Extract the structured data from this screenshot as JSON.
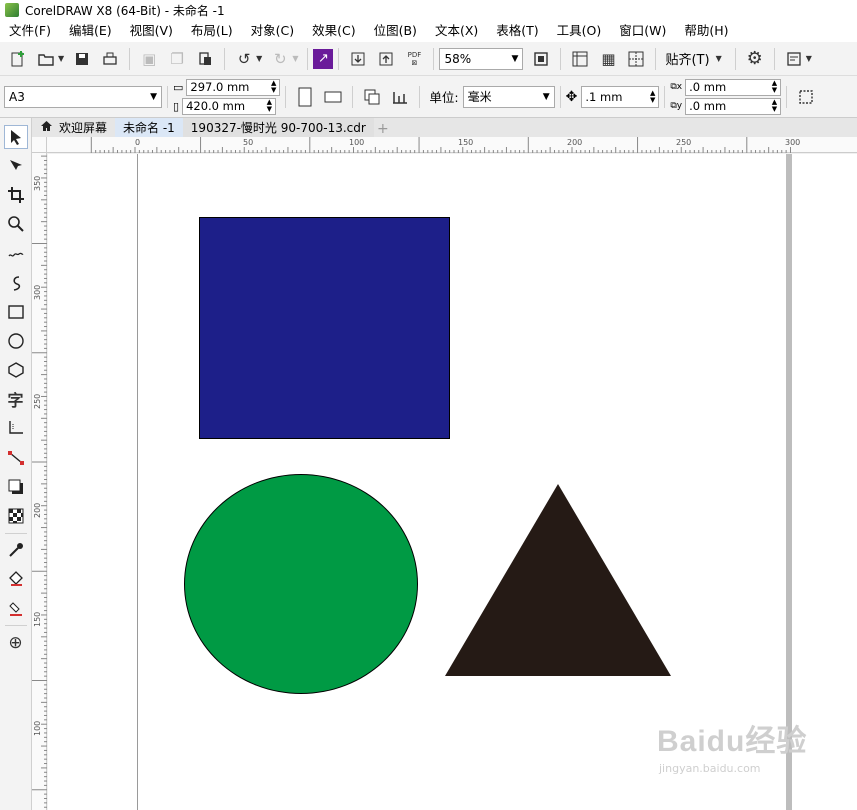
{
  "window": {
    "title": "CorelDRAW X8 (64-Bit) - 未命名 -1"
  },
  "menubar": [
    "文件(F)",
    "编辑(E)",
    "视图(V)",
    "布局(L)",
    "对象(C)",
    "效果(C)",
    "位图(B)",
    "文本(X)",
    "表格(T)",
    "工具(O)",
    "窗口(W)",
    "帮助(H)"
  ],
  "toolbar": {
    "zoom": "58%",
    "snap_label": "贴齐(T)",
    "pdf_label": "PDF"
  },
  "property_bar": {
    "page_size": "A3",
    "width": "297.0 mm",
    "height": "420.0 mm",
    "unit_label": "单位:",
    "unit": "毫米",
    "nudge": ".1 mm",
    "dup_x": ".0 mm",
    "dup_y": ".0 mm"
  },
  "doc_tabs": [
    {
      "label": "欢迎屏幕",
      "active": false
    },
    {
      "label": "未命名 -1",
      "active": true
    },
    {
      "label": "190327-慢时光 90-700-13.cdr",
      "active": false
    }
  ],
  "ruler": {
    "top_ticks": [
      "0",
      "50",
      "100",
      "150",
      "200",
      "250",
      "300"
    ],
    "left_ticks": [
      "350",
      "300",
      "250",
      "200",
      "150",
      "100"
    ]
  },
  "colors": {
    "rect_fill": "#1d1f89",
    "ellipse_fill": "#009a44",
    "triangle_fill": "#251a15",
    "accent": "#6a1b9a"
  },
  "watermark": {
    "main": "Baidu经验",
    "sub": "jingyan.baidu.com"
  }
}
